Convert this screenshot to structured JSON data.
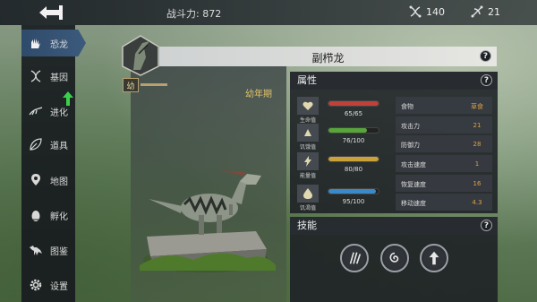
{
  "topbar": {
    "power_label": "战斗力: 872",
    "dna_count": "140",
    "gene_count": "21"
  },
  "sidebar": {
    "items": [
      {
        "label": "恐龙",
        "icon": "hand-claw-icon",
        "active": true
      },
      {
        "label": "基因",
        "icon": "dna-icon"
      },
      {
        "label": "进化",
        "icon": "evolution-icon"
      },
      {
        "label": "道具",
        "icon": "leaf-icon"
      },
      {
        "label": "地图",
        "icon": "map-pin-icon"
      },
      {
        "label": "孵化",
        "icon": "egg-icon"
      },
      {
        "label": "图鉴",
        "icon": "dinosaur-icon"
      },
      {
        "label": "设置",
        "icon": "gear-icon"
      }
    ]
  },
  "dino": {
    "name": "副栉龙",
    "level_badge": "幼",
    "age_stage": "幼年期"
  },
  "attributes": {
    "header": "属性",
    "vitals": [
      {
        "label": "生命值",
        "value": "65/65",
        "fill": 1.0,
        "color": "#c0403a"
      },
      {
        "label": "饥饿值",
        "value": "76/100",
        "fill": 0.76,
        "color": "#58a63a"
      },
      {
        "label": "能量值",
        "value": "80/80",
        "fill": 1.0,
        "color": "#c9a23a"
      },
      {
        "label": "饥渴值",
        "value": "95/100",
        "fill": 0.95,
        "color": "#3a8ac9"
      }
    ],
    "stats": [
      {
        "key": "食物",
        "value": "草食"
      },
      {
        "key": "攻击力",
        "value": "21"
      },
      {
        "key": "防御力",
        "value": "28"
      },
      {
        "key": "攻击速度",
        "value": "1"
      },
      {
        "key": "恢复速度",
        "value": "16"
      },
      {
        "key": "移动速度",
        "value": "4.3"
      }
    ]
  },
  "skills": {
    "header": "技能",
    "items": [
      {
        "icon": "claw-slash-icon"
      },
      {
        "icon": "swirl-icon"
      },
      {
        "icon": "up-arrow-icon"
      }
    ]
  },
  "colors": {
    "accent_gold": "#e3c26a",
    "value_orange": "#e0a040",
    "active_nav": "#3c5a7c"
  }
}
